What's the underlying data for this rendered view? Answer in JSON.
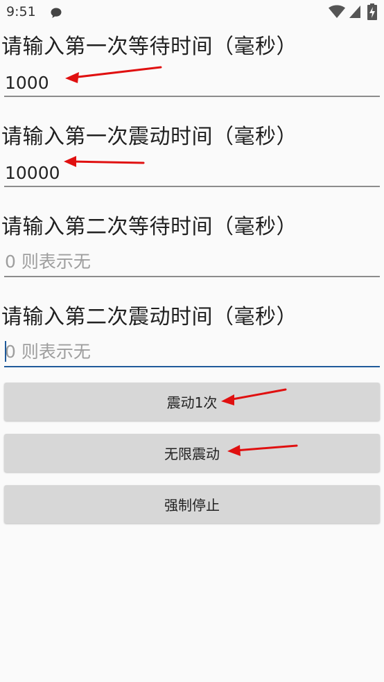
{
  "status_bar": {
    "time": "9:51",
    "icons": [
      "message-icon",
      "wifi-icon",
      "signal-icon",
      "battery-charging-icon"
    ]
  },
  "fields": [
    {
      "prompt": "请输入第一次等待时间（毫秒）",
      "value": "1000",
      "placeholder": ""
    },
    {
      "prompt": "请输入第一次震动时间（毫秒）",
      "value": "10000",
      "placeholder": ""
    },
    {
      "prompt": "请输入第二次等待时间（毫秒）",
      "value": "",
      "placeholder": "0 则表示无"
    },
    {
      "prompt": "请输入第二次震动时间（毫秒）",
      "value": "",
      "placeholder": "0 则表示无"
    }
  ],
  "buttons": {
    "vibrate_once": "震动1次",
    "vibrate_infinite": "无限震动",
    "force_stop": "强制停止"
  },
  "colors": {
    "background": "#fafafa",
    "button": "#d7d7d7",
    "underline": "#8c8c8c",
    "focus_underline": "#1f5a9a",
    "annotation_arrow": "#e01010"
  }
}
